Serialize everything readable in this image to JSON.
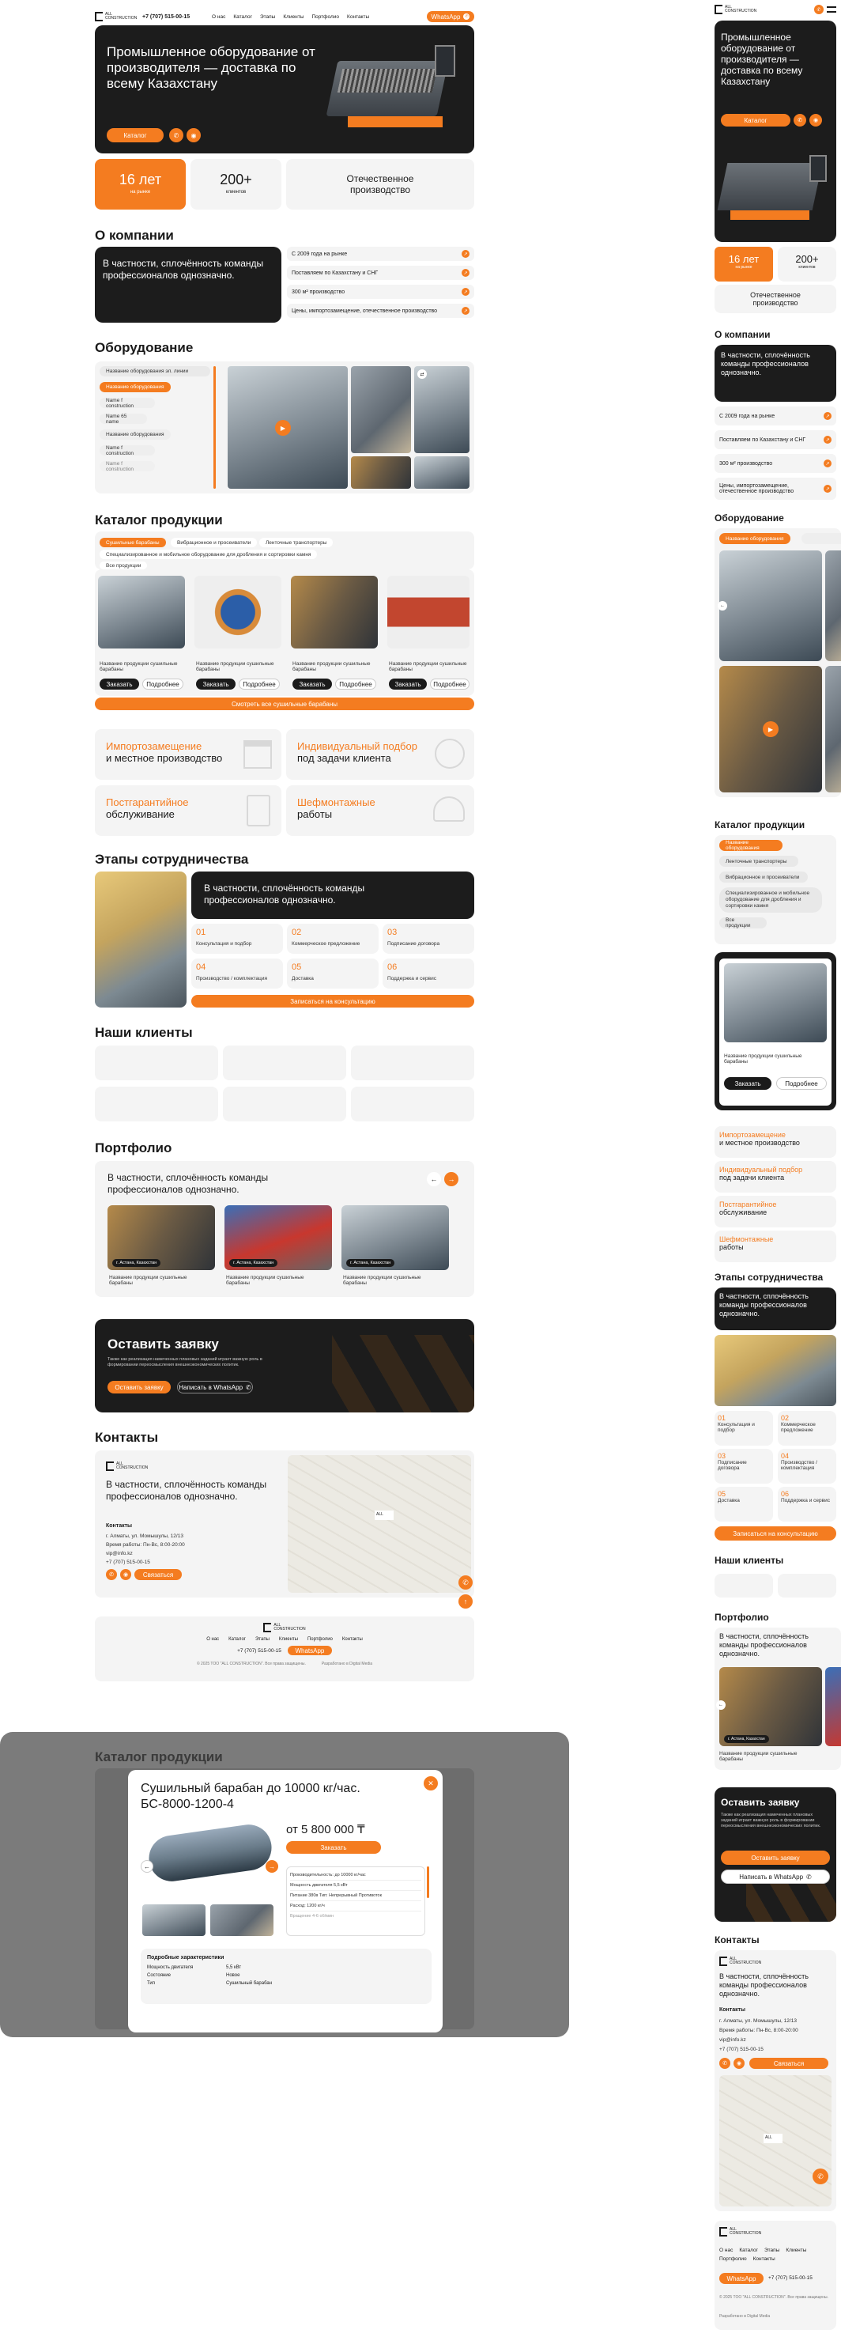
{
  "header": {
    "logo_line1": "ALL",
    "logo_line2": "CONSTRUCTION",
    "phone": "+7 (707) 515-00-15",
    "nav": [
      "О нас",
      "Каталог",
      "Этапы",
      "Клиенты",
      "Портфолио",
      "Контакты"
    ],
    "whatsapp": "WhatsApp"
  },
  "hero": {
    "title": "Промышленное оборудование от производителя — доставка по всему Казахстану",
    "cta": "Каталог"
  },
  "stats": {
    "years": "16 лет",
    "years_sub": "на рынке",
    "clients": "200+",
    "clients_sub": "клиентов",
    "own": "Отечественное производство"
  },
  "about": {
    "title": "О компании",
    "text": "В частности, сплочённость команды профессионалов однозначно.",
    "items": [
      "С 2009 года на рынке",
      "Поставляем по Казахстану и СНГ",
      "300 м² производство",
      "Цены, импортозамещение, отечественное производство"
    ]
  },
  "equipment": {
    "title": "Оборудование",
    "list": [
      "Название оборудования эл. линии",
      "Название оборудования",
      "Name f construction",
      "Name 65 name",
      "Название оборудования",
      "Name f construction",
      "Name f construction"
    ]
  },
  "catalog": {
    "title": "Каталог продукции",
    "tabs": [
      "Сушильные барабаны",
      "Вибрационное и просеиватели",
      "Ленточные транспортеры",
      "Специализированное и мобильное оборудование для дробления и сортировки камня",
      "Все продукции"
    ],
    "product_name": "Название продукции сушильные барабаны",
    "order": "Заказать",
    "more": "Подробнее",
    "all_button": "Смотреть все сушильные барабаны"
  },
  "features": [
    {
      "orange": "Импортозамещение",
      "dark": "и местное производство"
    },
    {
      "orange": "Индивидуальный подбор",
      "dark": "под задачи клиента"
    },
    {
      "orange": "Постгарантийное",
      "dark": "обслуживание"
    },
    {
      "orange": "Шефмонтажные",
      "dark": "работы"
    }
  ],
  "stages": {
    "title": "Этапы сотрудничества",
    "text": "В частности, сплочённость команды профессионалов однозначно.",
    "steps": [
      {
        "n": "01",
        "t": "Консультация и подбор"
      },
      {
        "n": "02",
        "t": "Коммерческое предложение"
      },
      {
        "n": "03",
        "t": "Подписание договора"
      },
      {
        "n": "04",
        "t": "Производство / комплектация"
      },
      {
        "n": "05",
        "t": "Доставка"
      },
      {
        "n": "06",
        "t": "Поддержка и сервис"
      }
    ],
    "button": "Записаться на консультацию"
  },
  "clients": {
    "title": "Наши клиенты"
  },
  "portfolio": {
    "title": "Портфолио",
    "text": "В частности, сплочённость команды профессионалов однозначно.",
    "tag": "г. Астана, Казахстан",
    "item": "Название продукции сушильные барабаны"
  },
  "request": {
    "title": "Оставить заявку",
    "text": "Также как реализация намеченных плановых заданий играет важную роль в формировании переосмысления внешнеэкономических политик.",
    "button": "Оставить заявку",
    "whatsapp": "Написать в WhatsApp"
  },
  "contacts": {
    "title": "Контакты",
    "text": "В частности, сплочённость команды профессионалов однозначно.",
    "sub": "Контакты",
    "address": "г. Алматы, ул. Момышулы, 12/13",
    "hours": "Время работы: Пн-Вс, 8:00-20:00",
    "email": "vip@info.kz",
    "phone": "+7 (707) 515-00-15",
    "button": "Связаться"
  },
  "footer": {
    "nav": [
      "О нас",
      "Каталог",
      "Этапы",
      "Клиенты",
      "Портфолио",
      "Контакты"
    ],
    "phone": "+7 (707) 515-00-15",
    "whatsapp": "WhatsApp",
    "copyright": "© 2025 TOO \"ALL CONSTRUCTION\". Все права защищены.",
    "dev": "Разработано в Digital Media"
  },
  "modal": {
    "bg_title": "Каталог продукции",
    "title": "Сушильный барабан до 10000 кг/час. БС-8000-1200-4",
    "price": "от 5 800 000 ₸",
    "order": "Заказать",
    "specs": [
      "Производительность: до 10000 кг/час",
      "Мощность двигателя 5,5 кВт",
      "Питание 380в Тип: Непрерывный Противоток",
      "Расход: 1200 кг/ч",
      "Вращение 4-6 об/мин"
    ],
    "char_title": "Подробные характеристики",
    "chars": [
      {
        "k": "Мощность двигателя",
        "v": "5,5 кВт"
      },
      {
        "k": "Состояние",
        "v": "Новое"
      },
      {
        "k": "Тип",
        "v": "Сушильный барабан"
      }
    ]
  },
  "mobile": {
    "about_items": [
      "С 2009 года на рынке",
      "Поставляем по Казахстану и СНГ",
      "300 м² производство",
      "Цены, импортозамещение, отечественное производство"
    ],
    "equip_pill": "Название оборудования",
    "catalog_tabs": [
      "Название оборудования",
      "Ленточные транспортеры",
      "Вибрационное и просеиватели",
      "Специализированное и мобильное оборудование для дробления и сортировки камня",
      "Все продукции"
    ],
    "stages": [
      {
        "n": "01",
        "t": "Консультация и подбор"
      },
      {
        "n": "02",
        "t": "Коммерческое предложение"
      },
      {
        "n": "03",
        "t": "Подписание договора"
      },
      {
        "n": "04",
        "t": "Производство / комплектация"
      },
      {
        "n": "05",
        "t": "Доставка"
      },
      {
        "n": "06",
        "t": "Поддержка и сервис"
      }
    ],
    "footer_nav": [
      "О нас",
      "Каталог",
      "Этапы",
      "Клиенты",
      "Портфолио",
      "Контакты"
    ]
  }
}
